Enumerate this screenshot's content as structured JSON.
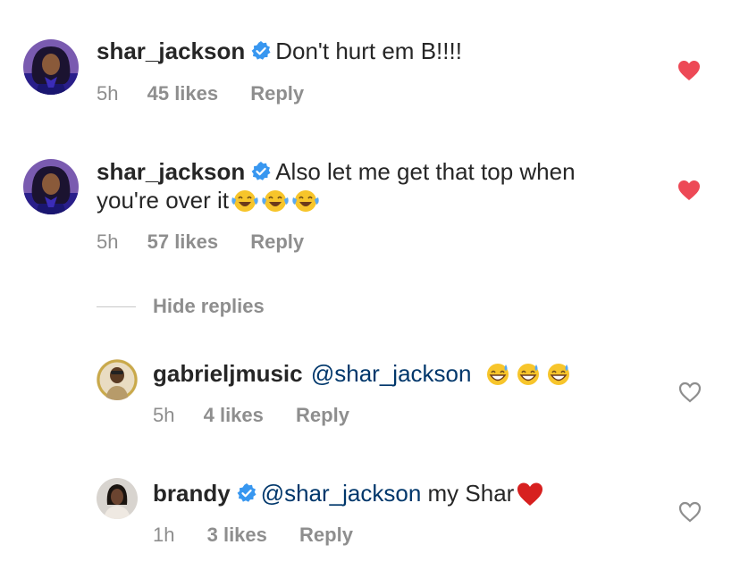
{
  "comments": [
    {
      "username": "shar_jackson",
      "verified": true,
      "text": "Don't hurt em B!!!!",
      "time": "5h",
      "likes": "45 likes",
      "reply": "Reply",
      "liked": true
    },
    {
      "username": "shar_jackson",
      "verified": true,
      "text_line1": "Also let me get that top when",
      "text_line2": "you're over it",
      "emojis": [
        "face-with-tears-of-joy",
        "face-with-tears-of-joy",
        "face-with-tears-of-joy"
      ],
      "time": "5h",
      "likes": "57 likes",
      "reply": "Reply",
      "liked": true
    }
  ],
  "hide_replies": "Hide replies",
  "replies": [
    {
      "username": "gabrieljmusic",
      "verified": false,
      "mention": "@shar_jackson",
      "text": "",
      "emojis": [
        "grinning-face-with-sweat",
        "grinning-face-with-sweat",
        "grinning-face-with-sweat"
      ],
      "time": "5h",
      "likes": "4 likes",
      "reply": "Reply",
      "liked": false
    },
    {
      "username": "brandy",
      "verified": true,
      "mention": "@shar_jackson",
      "text": " my Shar",
      "emojis": [
        "red-heart"
      ],
      "time": "1h",
      "likes": "3 likes",
      "reply": "Reply",
      "liked": false
    }
  ],
  "colors": {
    "liked_heart": "#ed4956",
    "verified_badge": "#3897f0",
    "mention": "#00376b",
    "meta": "#8e8e8e"
  }
}
